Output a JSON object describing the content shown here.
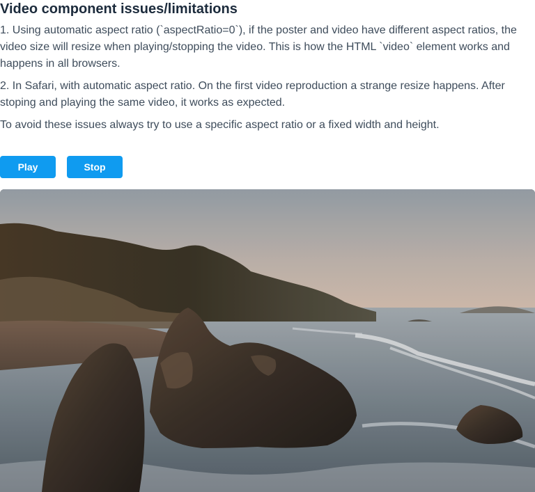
{
  "page": {
    "title": "Video component issues/limitations",
    "paragraphs": [
      "1. Using automatic aspect ratio (`aspectRatio=0`), if the poster and video have different aspect ratios, the video size will resize when playing/stopping the video. This is how the HTML `video` element works and happens in all browsers.",
      "2. In Safari, with automatic aspect ratio. On the first video reproduction a strange resize happens. After stoping and playing the same video, it works as expected.",
      "To avoid these issues always try to use a specific aspect ratio or a fixed width and height."
    ]
  },
  "controls": {
    "play_label": "Play",
    "stop_label": "Stop"
  },
  "video": {
    "poster_subject": "coastal sea rocks at sunset",
    "colors": {
      "sky_top": "#9aa3ab",
      "sky_horizon": "#d8c3b4",
      "sea": "#7d8a94",
      "rocks": "#2e2620",
      "hills": "#3a3326",
      "foam": "#e4e6e8"
    }
  },
  "theme": {
    "accent": "#0f9bf0",
    "title_color": "#1c2b3c",
    "text_color": "#3e4c5b"
  }
}
